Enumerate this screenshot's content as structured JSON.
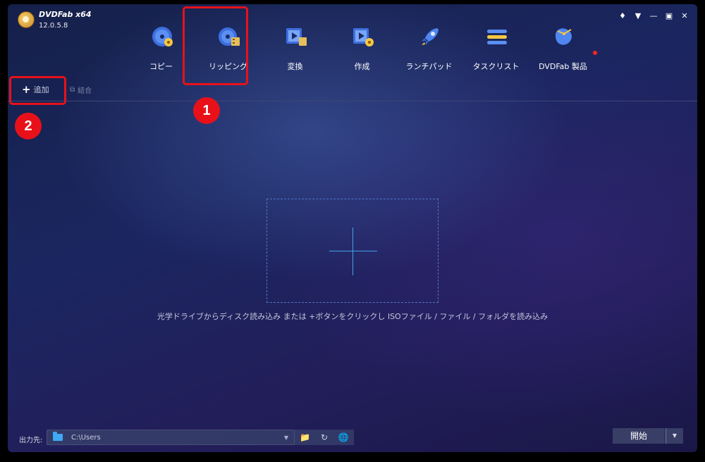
{
  "app": {
    "name": "DVDFab x64",
    "version": "12.0.5.8"
  },
  "window_controls": [
    "skin-icon",
    "menu-icon",
    "minimize-icon",
    "maximize-icon",
    "close-icon"
  ],
  "nav": {
    "items": [
      {
        "label": "コピー",
        "icon": "disc-copy-icon",
        "selected": false
      },
      {
        "label": "リッピング",
        "icon": "disc-rip-icon",
        "selected": true
      },
      {
        "label": "変換",
        "icon": "video-convert-icon",
        "selected": false
      },
      {
        "label": "作成",
        "icon": "video-create-icon",
        "selected": false
      },
      {
        "label": "ランチパッド",
        "icon": "rocket-icon",
        "selected": false
      },
      {
        "label": "タスクリスト",
        "icon": "task-list-icon",
        "selected": false
      },
      {
        "label": "DVDFab 製品",
        "icon": "products-icon",
        "selected": false
      }
    ]
  },
  "toolbar": {
    "add_label": "追加",
    "merge_label": "結合"
  },
  "annotations": {
    "badge_1": "1",
    "badge_2": "2"
  },
  "drop_zone": {
    "hint": "光学ドライブからディスク読み込み または +ボタンをクリックし ISOファイル / ファイル / フォルダを読み込み"
  },
  "output": {
    "label": "出力先:",
    "path": "C:\\Users"
  },
  "start_button": {
    "label": "開始"
  },
  "colors": {
    "highlight": "#e8111a",
    "accent": "#3fa3e6"
  }
}
